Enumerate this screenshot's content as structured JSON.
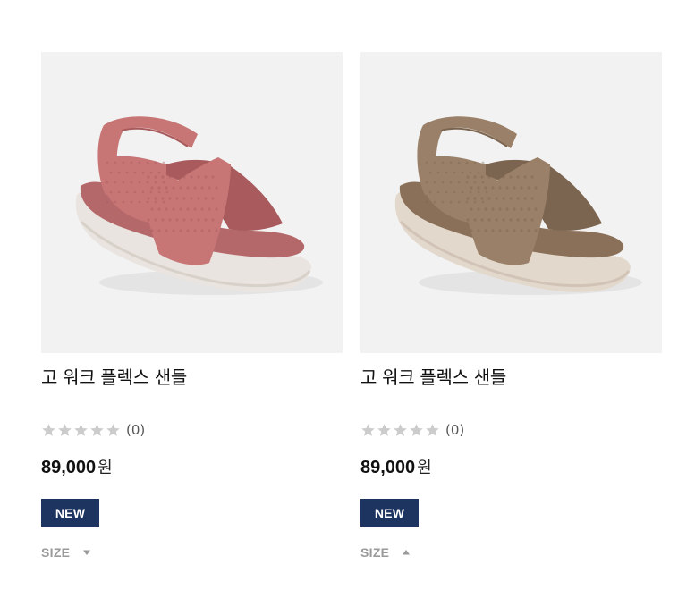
{
  "products": [
    {
      "name": "고 워크 플렉스 샌들",
      "rating_count": "(0)",
      "price": "89,000",
      "currency": "원",
      "badge": "NEW",
      "size_label": "SIZE",
      "size_expanded": false,
      "rating": 0,
      "image": {
        "icon": "sandal-image",
        "colors": {
          "upper": "#c77675",
          "upper_dark": "#a85a5c",
          "insole": "#b5686a",
          "sole": "#e9e4df",
          "sole_edge": "#d8d1ca"
        }
      }
    },
    {
      "name": "고 워크 플렉스 샌들",
      "rating_count": "(0)",
      "price": "89,000",
      "currency": "원",
      "badge": "NEW",
      "size_label": "SIZE",
      "size_expanded": true,
      "rating": 0,
      "image": {
        "icon": "sandal-image",
        "colors": {
          "upper": "#9a8068",
          "upper_dark": "#7c6550",
          "insole": "#8a7058",
          "sole": "#e3d8cc",
          "sole_edge": "#d1c4b6"
        }
      }
    }
  ],
  "theme": {
    "badge_bg": "#1d3461",
    "star_empty": "#cccccc",
    "size_label_color": "#9a9a9a"
  }
}
